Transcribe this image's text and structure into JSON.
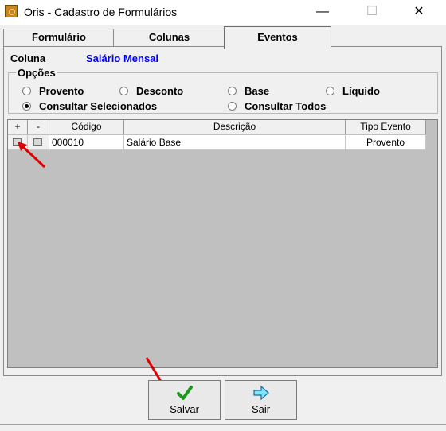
{
  "window": {
    "title": "Oris - Cadastro de Formulários",
    "controls": {
      "minimize": "—",
      "maximize": "☐",
      "close": "✕"
    }
  },
  "tabs": [
    {
      "label": "Formulário"
    },
    {
      "label": "Colunas"
    },
    {
      "label": "Eventos"
    }
  ],
  "coluna": {
    "label": "Coluna",
    "value": "Salário Mensal"
  },
  "opcoes": {
    "legend": "Opções",
    "options": [
      {
        "label": "Provento",
        "selected": false
      },
      {
        "label": "Desconto",
        "selected": false
      },
      {
        "label": "Base",
        "selected": false
      },
      {
        "label": "Líquido",
        "selected": false
      },
      {
        "label": "Consultar Selecionados",
        "selected": true
      },
      {
        "label": "Consultar Todos",
        "selected": false
      }
    ]
  },
  "grid": {
    "headers": {
      "plus": "+",
      "minus": "-",
      "codigo": "Código",
      "descricao": "Descrição",
      "tipo": "Tipo Evento"
    },
    "rows": [
      {
        "codigo": "000010",
        "descricao": "Salário Base",
        "tipo": "Provento"
      }
    ]
  },
  "buttons": {
    "salvar": {
      "label": "Salvar",
      "icon": "check-icon"
    },
    "sair": {
      "label": "Sair",
      "icon": "arrow-right-icon"
    }
  },
  "colors": {
    "accent_blue": "#0000ff",
    "check_green": "#1a9a1a",
    "arrow_red": "#e00000"
  }
}
